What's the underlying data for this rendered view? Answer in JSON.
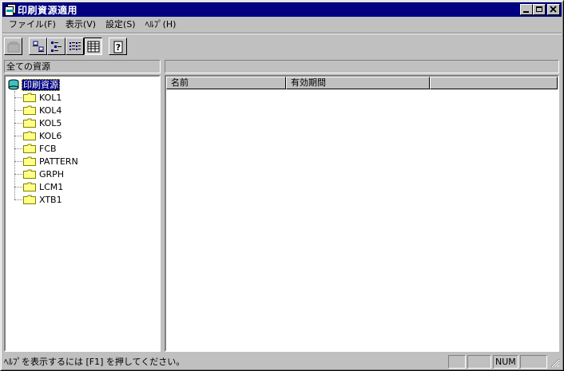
{
  "window": {
    "title": "印刷資源適用"
  },
  "menu": [
    {
      "label": "ファイル(F)"
    },
    {
      "label": "表示(V)"
    },
    {
      "label": "設定(S)"
    },
    {
      "label": "ﾍﾙﾌﾟ(H)"
    }
  ],
  "toolbar": [
    {
      "icon": "up-folder-icon"
    },
    {
      "icon": "large-icons-icon"
    },
    {
      "icon": "small-icons-icon"
    },
    {
      "icon": "list-icon"
    },
    {
      "icon": "details-icon",
      "pressed": true
    },
    {
      "icon": "help-icon"
    }
  ],
  "left_pane": {
    "header": "全ての資源",
    "root": {
      "label": "印刷資源"
    },
    "folders": [
      "KOL1",
      "KOL4",
      "KOL5",
      "KOL6",
      "FCB",
      "PATTERN",
      "GRPH",
      "LCM1",
      "XTB1"
    ]
  },
  "right_pane": {
    "header": "",
    "columns": [
      {
        "label": "名前"
      },
      {
        "label": "有効期間"
      },
      {
        "label": ""
      }
    ]
  },
  "status": {
    "text": "ﾍﾙﾌﾟを表示するには [F1] を押してください。",
    "num": "NUM"
  },
  "colors": {
    "titlebar": "#000080",
    "face": "#c0c0c0",
    "selection": "#000080"
  }
}
